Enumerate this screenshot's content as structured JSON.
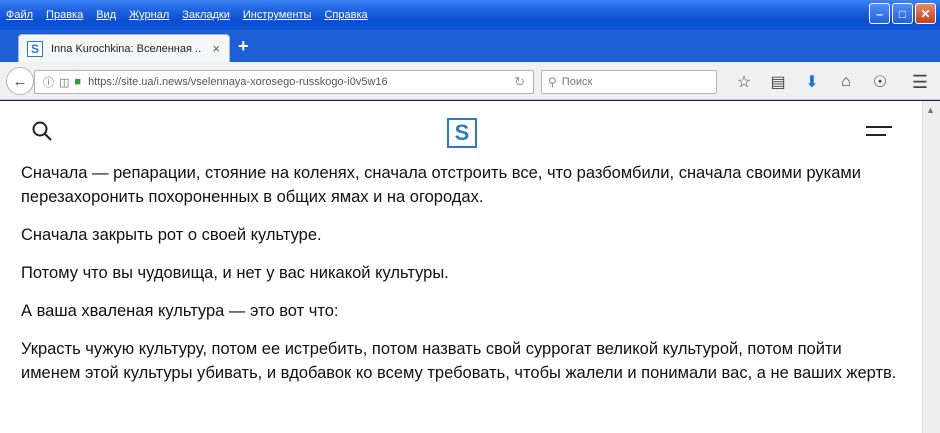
{
  "menu": [
    "Файл",
    "Правка",
    "Вид",
    "Журнал",
    "Закладки",
    "Инструменты",
    "Справка"
  ],
  "window_controls": {
    "minimize": "–",
    "maximize": "□",
    "close": "✕"
  },
  "tab": {
    "favicon_letter": "S",
    "title": "Inna Kurochkina: Вселенная ...",
    "close": "×",
    "new_tab": "+"
  },
  "navbar": {
    "url": "https://site.ua/i.news/vselennaya-xorosego-russkogo-i0v5w16",
    "search_placeholder": "Поиск"
  },
  "site": {
    "logo_letter": "S"
  },
  "article": {
    "paragraphs": [
      "Сначала — репарации, стояние на коленях, сначала отстроить все, что разбомбили, сначала своими руками перезахоронить похороненных в общих ямах и на огородах.",
      "Сначала закрыть рот о своей культуре.",
      "Потому что вы чудовища, и нет у вас никакой культуры.",
      "А ваша хваленая культура — это вот что:",
      "Украсть чужую культуру, потом ее истребить, потом назвать свой суррогат великой культурой, потом пойти именем этой культуры убивать, и вдобавок ко всему требовать, чтобы жалели и понимали вас, а не ваших жертв."
    ]
  },
  "colors": {
    "titlebar": "#1f63e0",
    "accent": "#2a7ac8",
    "download": "#1a72d6",
    "lock": "#2e9e2e"
  },
  "icons": [
    "back-arrow-icon",
    "info-icon",
    "shield-icon",
    "lock-icon",
    "reload-icon",
    "search-icon",
    "bookmark-star-icon",
    "reading-list-icon",
    "download-icon",
    "home-icon",
    "pocket-icon",
    "hamburger-menu-icon"
  ]
}
